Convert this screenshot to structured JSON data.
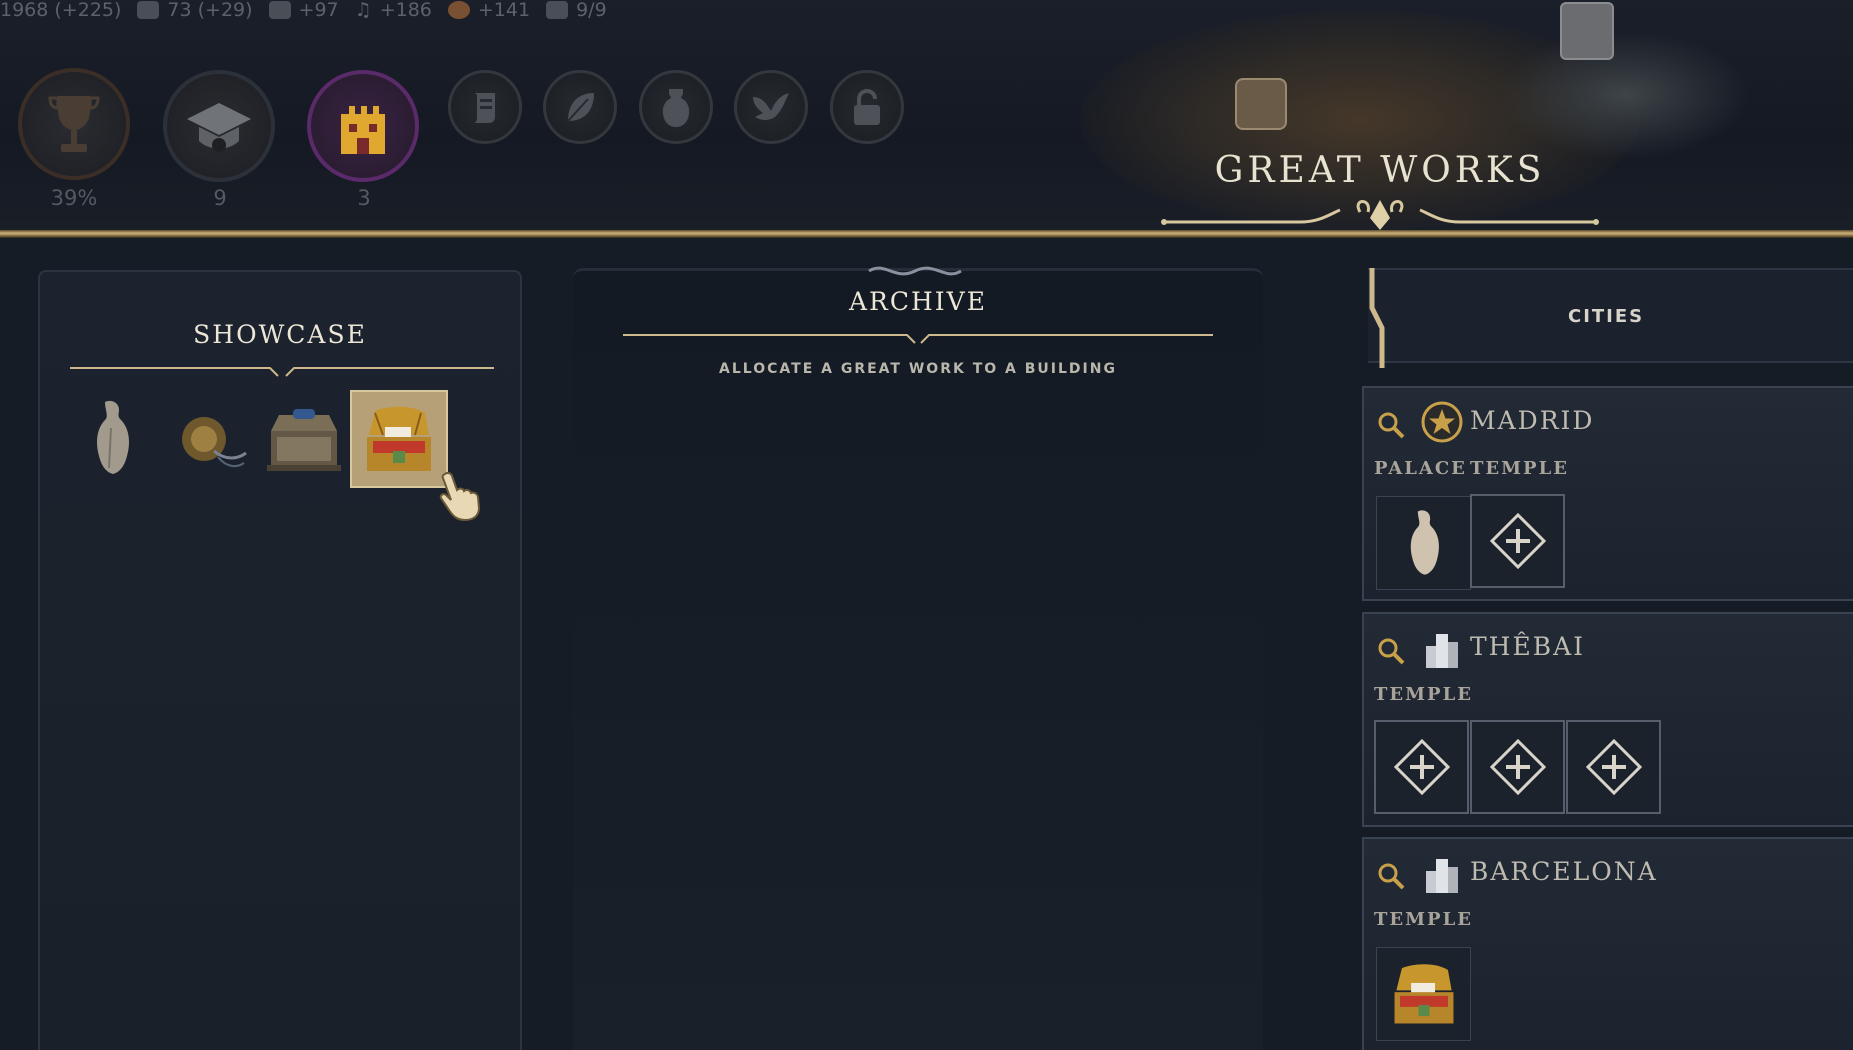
{
  "top_stats": [
    {
      "icon": "science-icon",
      "value": "1968 (+225)"
    },
    {
      "icon": "globe-icon",
      "value": "73 (+29)"
    },
    {
      "icon": "faith-icon",
      "value": "+97"
    },
    {
      "icon": "music-icon",
      "value": "+186"
    },
    {
      "icon": "happiness-icon",
      "value": "+141"
    },
    {
      "icon": "buildings-icon",
      "value": "9/9"
    }
  ],
  "victory_buttons": [
    {
      "name": "trophy",
      "label": "39%"
    },
    {
      "name": "great-people",
      "label": "9"
    },
    {
      "name": "castle",
      "label": "3"
    }
  ],
  "great_works": {
    "title": "GREAT WORKS"
  },
  "showcase": {
    "title": "SHOWCASE",
    "items": [
      "marble-statue-icon",
      "golden-relic-icon",
      "reliquary-chest-icon",
      "treasure-chest-icon"
    ]
  },
  "archive": {
    "title": "ARCHIVE",
    "subtitle": "ALLOCATE A GREAT WORK TO A BUILDING"
  },
  "cities": {
    "title": "CITIES",
    "list": [
      {
        "name": "MADRID",
        "capital": true,
        "buildings": [
          "PALACE",
          "TEMPLE"
        ]
      },
      {
        "name": "THÊBAI",
        "capital": false,
        "buildings": [
          "TEMPLE"
        ]
      },
      {
        "name": "BARCELONA",
        "capital": false,
        "buildings": [
          "TEMPLE"
        ]
      }
    ]
  }
}
